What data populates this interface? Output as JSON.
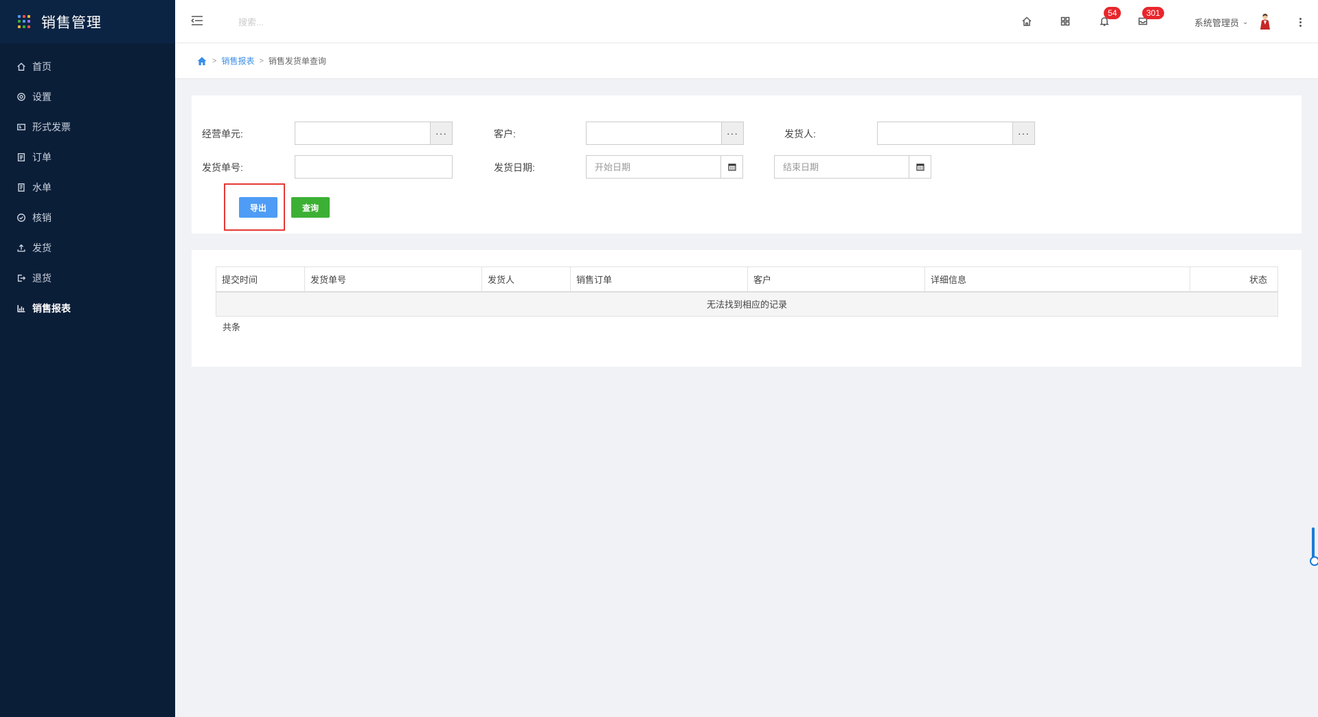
{
  "app": {
    "title": "销售管理"
  },
  "sidebar": {
    "items": [
      {
        "label": "首页",
        "icon": "home-icon"
      },
      {
        "label": "设置",
        "icon": "gear-icon"
      },
      {
        "label": "形式发票",
        "icon": "invoice-icon"
      },
      {
        "label": "订单",
        "icon": "order-icon"
      },
      {
        "label": "水单",
        "icon": "receipt-icon"
      },
      {
        "label": "核销",
        "icon": "check-circle-icon"
      },
      {
        "label": "发货",
        "icon": "upload-icon"
      },
      {
        "label": "退货",
        "icon": "return-icon"
      },
      {
        "label": "销售报表",
        "icon": "bar-chart-icon",
        "active": true
      }
    ]
  },
  "header": {
    "search_placeholder": "搜索...",
    "notification_count": "54",
    "message_count": "301",
    "user_name": "系统管理员"
  },
  "breadcrumb": {
    "parent": "销售报表",
    "current": "销售发货单查询"
  },
  "filter": {
    "business_unit_label": "经营单元:",
    "customer_label": "客户:",
    "shipper_label": "发货人:",
    "shipment_no_label": "发货单号:",
    "ship_date_label": "发货日期:",
    "start_date_placeholder": "开始日期",
    "end_date_placeholder": "结束日期",
    "lookup_button": "···",
    "export_button": "导出",
    "query_button": "查询"
  },
  "table": {
    "columns": [
      "提交时间",
      "发货单号",
      "发货人",
      "销售订单",
      "客户",
      "详细信息",
      "状态"
    ],
    "empty_text": "无法找到相应的记录",
    "total_text": "共条"
  },
  "colors": {
    "sidebar_bg": "#0b1e38",
    "accent": "#3a8ee6",
    "export_button": "#4e9cf5",
    "query_button": "#3cb034",
    "badge": "#e8262c",
    "highlight": "#e53935"
  }
}
